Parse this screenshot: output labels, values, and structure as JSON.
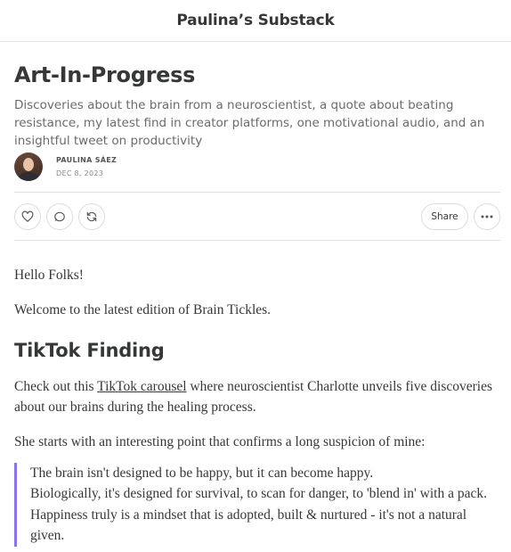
{
  "header": {
    "publication": "Paulina’s Substack"
  },
  "post": {
    "title": "Art-In-Progress",
    "subtitle": "Discoveries about the brain from a neuroscientist, a quote about beating resistance, my latest find in creator platforms, one motivational audio, and an insightful tweet on productivity",
    "author": "PAULINA SÁEZ",
    "date": "DEC 8, 2023"
  },
  "actions": {
    "like_icon": "heart-icon",
    "comment_icon": "comment-icon",
    "restack_icon": "restack-icon",
    "share_label": "Share",
    "more_icon": "more-icon"
  },
  "content": {
    "greeting": "Hello Folks!",
    "intro": "Welcome to the latest edition of Brain Tickles.",
    "section_heading": "TikTok Finding",
    "para1_before": "Check out this ",
    "para1_link": "TikTok carousel",
    "para1_after": " where neuroscientist Charlotte unveils five discoveries about our brains during the healing process.",
    "para2": "She starts with an interesting point that confirms a long suspicion of mine:",
    "quote_line1": "The brain isn't designed to be happy, but it can become happy.",
    "quote_line2": "Biologically, it's designed for survival, to scan for danger, to 'blend in' with a pack. Happiness truly is a mindset that is adopted, built & nurtured - it's not a natural given."
  },
  "colors": {
    "accent_quote_bar": "#8a73e6",
    "text": "#363737",
    "muted": "#6b6b6b"
  }
}
